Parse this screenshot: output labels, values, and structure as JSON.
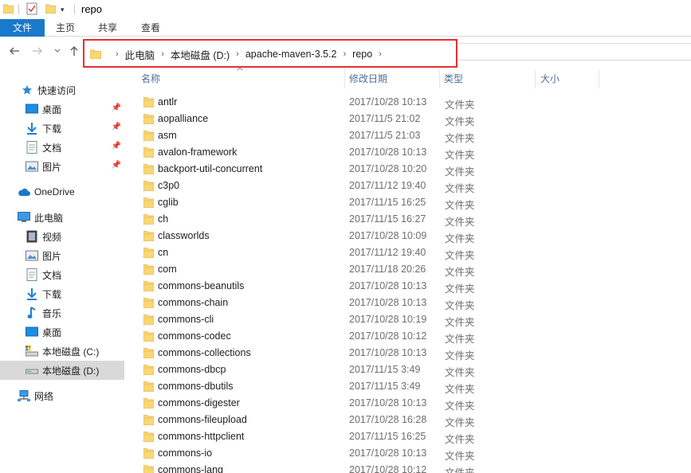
{
  "window": {
    "title": "repo"
  },
  "ribbon": {
    "tabs": [
      "文件",
      "主页",
      "共享",
      "查看"
    ]
  },
  "address": {
    "crumbs": [
      "此电脑",
      "本地磁盘 (D:)",
      "apache-maven-3.5.2",
      "repo"
    ]
  },
  "sidebar": {
    "quick_access": "快速访问",
    "quick_items": [
      "桌面",
      "下载",
      "文档",
      "图片"
    ],
    "onedrive": "OneDrive",
    "this_pc": "此电脑",
    "pc_items": [
      "视频",
      "图片",
      "文档",
      "下载",
      "音乐",
      "桌面",
      "本地磁盘 (C:)",
      "本地磁盘 (D:)"
    ],
    "network": "网络",
    "selected": "本地磁盘 (D:)"
  },
  "columns": {
    "name": "名称",
    "modified": "修改日期",
    "type": "类型",
    "size": "大小"
  },
  "files": [
    {
      "name": "antlr",
      "date": "2017/10/28 10:13",
      "type": "文件夹"
    },
    {
      "name": "aopalliance",
      "date": "2017/11/5 21:02",
      "type": "文件夹"
    },
    {
      "name": "asm",
      "date": "2017/11/5 21:03",
      "type": "文件夹"
    },
    {
      "name": "avalon-framework",
      "date": "2017/10/28 10:13",
      "type": "文件夹"
    },
    {
      "name": "backport-util-concurrent",
      "date": "2017/10/28 10:20",
      "type": "文件夹"
    },
    {
      "name": "c3p0",
      "date": "2017/11/12 19:40",
      "type": "文件夹"
    },
    {
      "name": "cglib",
      "date": "2017/11/15 16:25",
      "type": "文件夹"
    },
    {
      "name": "ch",
      "date": "2017/11/15 16:27",
      "type": "文件夹"
    },
    {
      "name": "classworlds",
      "date": "2017/10/28 10:09",
      "type": "文件夹"
    },
    {
      "name": "cn",
      "date": "2017/11/12 19:40",
      "type": "文件夹"
    },
    {
      "name": "com",
      "date": "2017/11/18 20:26",
      "type": "文件夹"
    },
    {
      "name": "commons-beanutils",
      "date": "2017/10/28 10:13",
      "type": "文件夹"
    },
    {
      "name": "commons-chain",
      "date": "2017/10/28 10:13",
      "type": "文件夹"
    },
    {
      "name": "commons-cli",
      "date": "2017/10/28 10:19",
      "type": "文件夹"
    },
    {
      "name": "commons-codec",
      "date": "2017/10/28 10:12",
      "type": "文件夹"
    },
    {
      "name": "commons-collections",
      "date": "2017/10/28 10:13",
      "type": "文件夹"
    },
    {
      "name": "commons-dbcp",
      "date": "2017/11/15 3:49",
      "type": "文件夹"
    },
    {
      "name": "commons-dbutils",
      "date": "2017/11/15 3:49",
      "type": "文件夹"
    },
    {
      "name": "commons-digester",
      "date": "2017/10/28 10:13",
      "type": "文件夹"
    },
    {
      "name": "commons-fileupload",
      "date": "2017/10/28 16:28",
      "type": "文件夹"
    },
    {
      "name": "commons-httpclient",
      "date": "2017/11/15 16:25",
      "type": "文件夹"
    },
    {
      "name": "commons-io",
      "date": "2017/10/28 10:13",
      "type": "文件夹"
    },
    {
      "name": "commons-lang",
      "date": "2017/10/28 10:12",
      "type": "文件夹"
    }
  ],
  "colors": {
    "accent": "#1979ca",
    "highlight": "#e53030",
    "folder": "#f8d775",
    "selected": "#d9d9d9"
  },
  "icons": {
    "folder": "folder-icon",
    "back": "back-arrow-icon",
    "forward": "forward-arrow-icon",
    "up": "up-arrow-icon",
    "star": "star-icon",
    "pin": "pin-icon",
    "onedrive": "cloud-icon",
    "pc": "computer-icon",
    "network": "network-icon"
  }
}
